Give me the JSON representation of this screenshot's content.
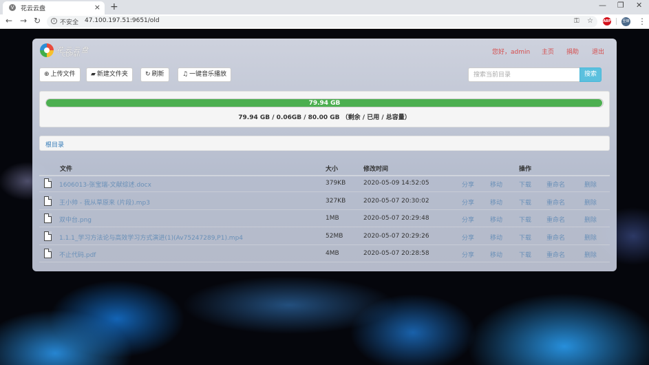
{
  "browser": {
    "tab_title": "花云云盘",
    "tab_favicon": "V",
    "tab_close": "×",
    "new_tab": "+",
    "security_label": "不安全",
    "url": "47.100.197.51:9651/old",
    "extension_abp": "ABP",
    "profile_label": "至锋"
  },
  "header": {
    "logo_text": "花云云盘",
    "logo_sub": "CDPan",
    "greeting": "您好，admin",
    "nav": [
      "主页",
      "捐助",
      "退出"
    ]
  },
  "toolbar": {
    "upload": "上传文件",
    "new_folder": "新建文件夹",
    "refresh": "刷新",
    "music": "一键音乐播放",
    "search_placeholder": "搜索当前目录",
    "search_button": "搜索"
  },
  "storage": {
    "bar_label": "79.94 GB",
    "remaining_fraction": 0.99925,
    "summary": "79.94 GB / 0.06GB / 80.00 GB （剩余 / 已用 / 总容量）"
  },
  "breadcrumb": "根目录",
  "table": {
    "headers": {
      "file": "文件",
      "size": "大小",
      "modified": "修改时间",
      "actions": "操作"
    },
    "actions": [
      "分享",
      "移动",
      "下载",
      "重命名",
      "删除"
    ],
    "rows": [
      {
        "name": "1606013-张宝瑞-文献综述.docx",
        "size": "379KB",
        "modified": "2020-05-09 14:52:05"
      },
      {
        "name": "王小帅 - 我从草原来 (片段).mp3",
        "size": "327KB",
        "modified": "2020-05-07 20:30:02"
      },
      {
        "name": "双中台.png",
        "size": "1MB",
        "modified": "2020-05-07 20:29:48"
      },
      {
        "name": "1.1.1_学习方法论与高效学习方式演进(1)(Av75247289,P1).mp4",
        "size": "52MB",
        "modified": "2020-05-07 20:29:26"
      },
      {
        "name": "不止代码.pdf",
        "size": "4MB",
        "modified": "2020-05-07 20:28:58"
      }
    ]
  },
  "colors": {
    "accent_link": "#6a90b8",
    "nav_red": "#d64d4d",
    "progress_green": "#4caf50",
    "search_blue": "#5bc0de"
  },
  "icons": {
    "upload": "upload-icon",
    "folder": "folder-open-icon",
    "refresh": "refresh-icon",
    "music": "music-icon",
    "file": "file-icon"
  }
}
